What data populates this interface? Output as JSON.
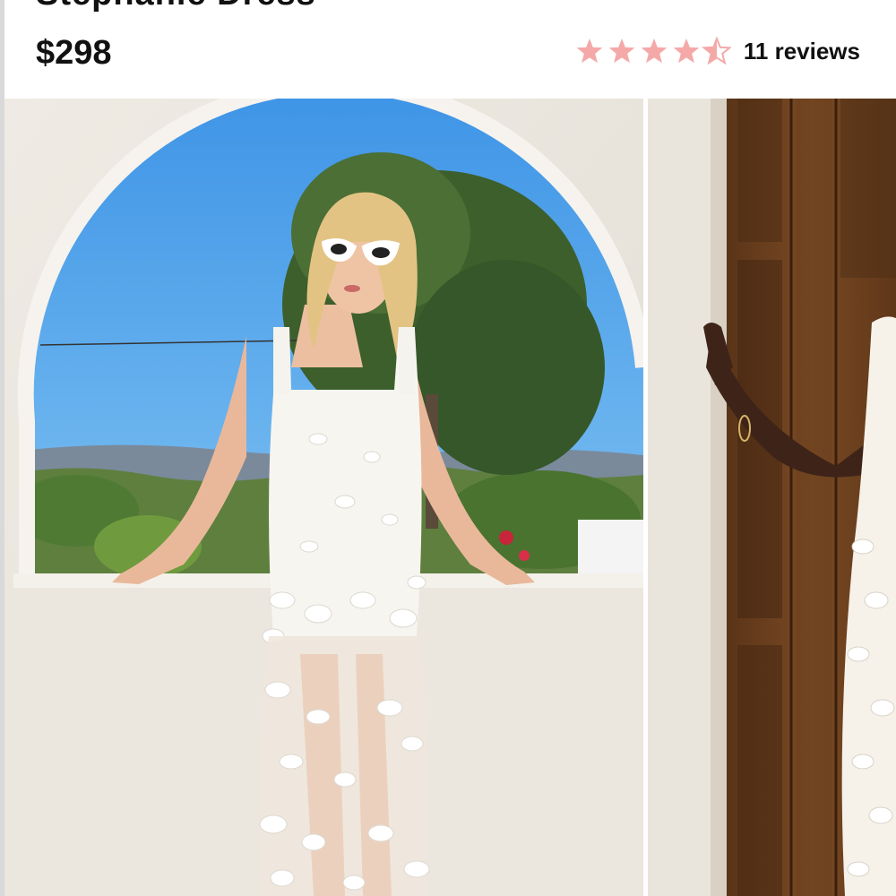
{
  "product": {
    "title": "Stephanie Dress",
    "price": "$298"
  },
  "rating": {
    "value": 4.5,
    "max": 5,
    "reviews_label": "11 reviews",
    "star_color": "#f4a9a8",
    "star_icon": "star-icon"
  },
  "gallery": {
    "images": [
      {
        "alt": "Model in white floral dress on balcony with arch and trees"
      },
      {
        "alt": "Model in white floral dress leaning against wooden door"
      }
    ]
  },
  "colors": {
    "text": "#111111",
    "sky": "#4a9fe8",
    "wall": "#ece8e1"
  }
}
